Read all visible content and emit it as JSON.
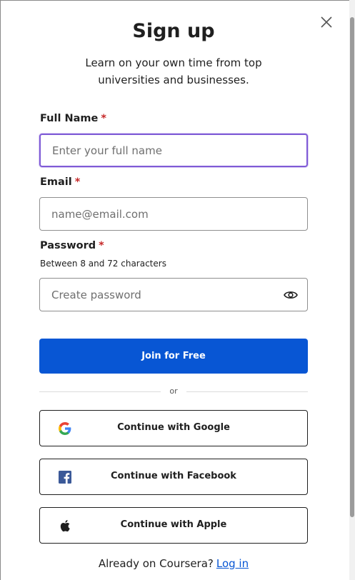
{
  "modal": {
    "title": "Sign up",
    "subtitle": "Learn on your own time from top universities and businesses."
  },
  "form": {
    "full_name": {
      "label": "Full Name",
      "required_mark": "*",
      "placeholder": "Enter your full name",
      "value": ""
    },
    "email": {
      "label": "Email",
      "required_mark": "*",
      "placeholder": "name@email.com",
      "value": ""
    },
    "password": {
      "label": "Password",
      "required_mark": "*",
      "hint": "Between 8 and 72 characters",
      "placeholder": "Create password",
      "value": ""
    }
  },
  "buttons": {
    "join": "Join for Free",
    "divider_text": "or",
    "google": "Continue with Google",
    "facebook": "Continue with Facebook",
    "apple": "Continue with Apple"
  },
  "footer": {
    "text": "Already on Coursera?",
    "login_link": "Log in"
  },
  "colors": {
    "primary": "#0856d4",
    "required": "#c62828",
    "focus_border": "#7f5bd6",
    "facebook": "#3b5998"
  },
  "icons": [
    "close-icon",
    "eye-icon",
    "google-icon",
    "facebook-icon",
    "apple-icon"
  ]
}
